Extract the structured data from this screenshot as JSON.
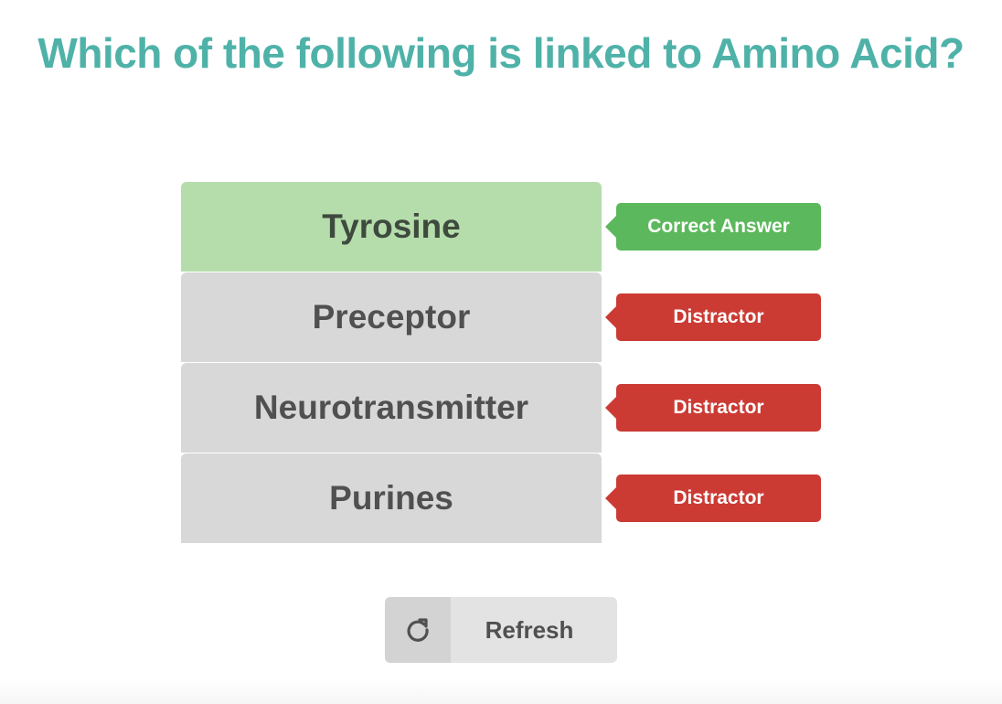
{
  "question": {
    "title": "Which of the following is linked to Amino Acid?"
  },
  "options": [
    {
      "label": "Tyrosine",
      "status": "correct",
      "badge": "Correct Answer"
    },
    {
      "label": "Preceptor",
      "status": "distractor",
      "badge": "Distractor"
    },
    {
      "label": "Neurotransmitter",
      "status": "distractor",
      "badge": "Distractor"
    },
    {
      "label": "Purines",
      "status": "distractor",
      "badge": "Distractor"
    }
  ],
  "refresh": {
    "label": "Refresh",
    "icon": "refresh-icon"
  },
  "colors": {
    "title": "#4fb2a8",
    "correct_option_bg": "#b5ddab",
    "option_bg": "#d9d8d8",
    "correct_badge": "#5cb85c",
    "distractor_badge": "#cb3b34"
  }
}
